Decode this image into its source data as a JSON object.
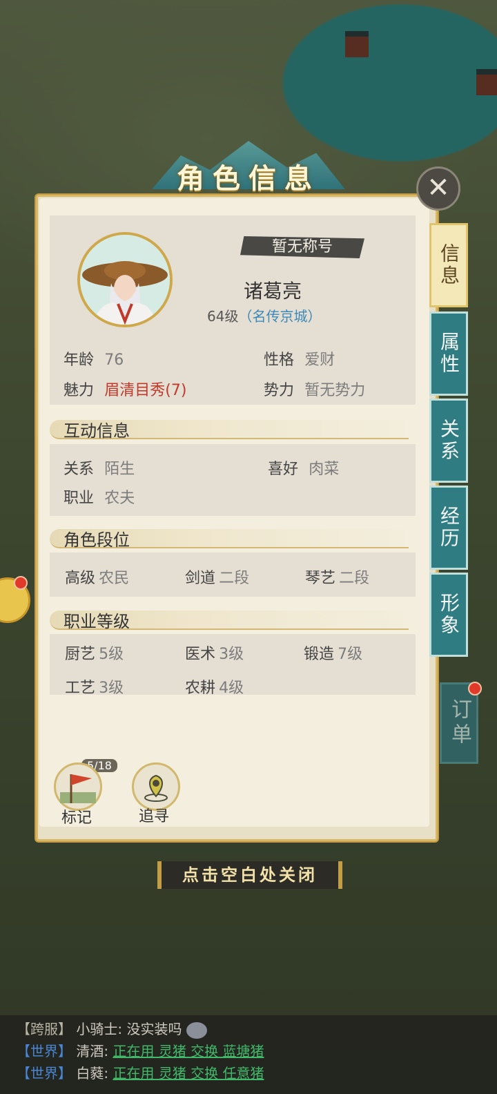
{
  "panel": {
    "title": "角色信息"
  },
  "character": {
    "honorific": "暂无称号",
    "name": "诸葛亮",
    "level": "64级",
    "fame": "（名传京城）",
    "age_label": "年龄",
    "age": "76",
    "personality_label": "性格",
    "personality": "爱财",
    "charm_label": "魅力",
    "charm": "眉清目秀(7)",
    "faction_label": "势力",
    "faction": "暂无势力"
  },
  "interaction": {
    "heading": "互动信息",
    "relation_label": "关系",
    "relation": "陌生",
    "hobby_label": "喜好",
    "hobby": "肉菜",
    "job_label": "职业",
    "job": "农夫"
  },
  "ranks": {
    "heading": "角色段位",
    "items": [
      {
        "label": "高级",
        "value": "农民"
      },
      {
        "label": "剑道",
        "value": "二段"
      },
      {
        "label": "琴艺",
        "value": "二段"
      }
    ]
  },
  "skills": {
    "heading": "职业等级",
    "items": [
      {
        "label": "厨艺",
        "value": "5级"
      },
      {
        "label": "医术",
        "value": "3级"
      },
      {
        "label": "锻造",
        "value": "7级"
      },
      {
        "label": "工艺",
        "value": "3级"
      },
      {
        "label": "农耕",
        "value": "4级"
      }
    ]
  },
  "tabs": [
    {
      "label": "信息",
      "active": true
    },
    {
      "label": "属性",
      "active": false
    },
    {
      "label": "关系",
      "active": false
    },
    {
      "label": "经历",
      "active": false
    },
    {
      "label": "形象",
      "active": false
    }
  ],
  "side": {
    "order_label": "订单"
  },
  "actions": {
    "mark_label": "标记",
    "mark_count": "5/18",
    "trace_label": "追寻"
  },
  "hint": "点击空白处关闭",
  "chat": [
    {
      "channel": "【跨服】",
      "user": "小骑士:",
      "text": "没实装吗",
      "link": ""
    },
    {
      "channel": "【世界】",
      "user": "清酒:",
      "text": "",
      "link": "正在用 灵猪 交换 蓝塘猪"
    },
    {
      "channel": "【世界】",
      "user": "白蕤:",
      "text": "",
      "link": "正在用 灵猪 交换 任意猪"
    }
  ],
  "colors": {
    "accent_teal": "#2f7d83",
    "gold": "#d8b864",
    "charm_red": "#c0392b",
    "fame_blue": "#3c89b9",
    "link_green": "#42b86a"
  }
}
